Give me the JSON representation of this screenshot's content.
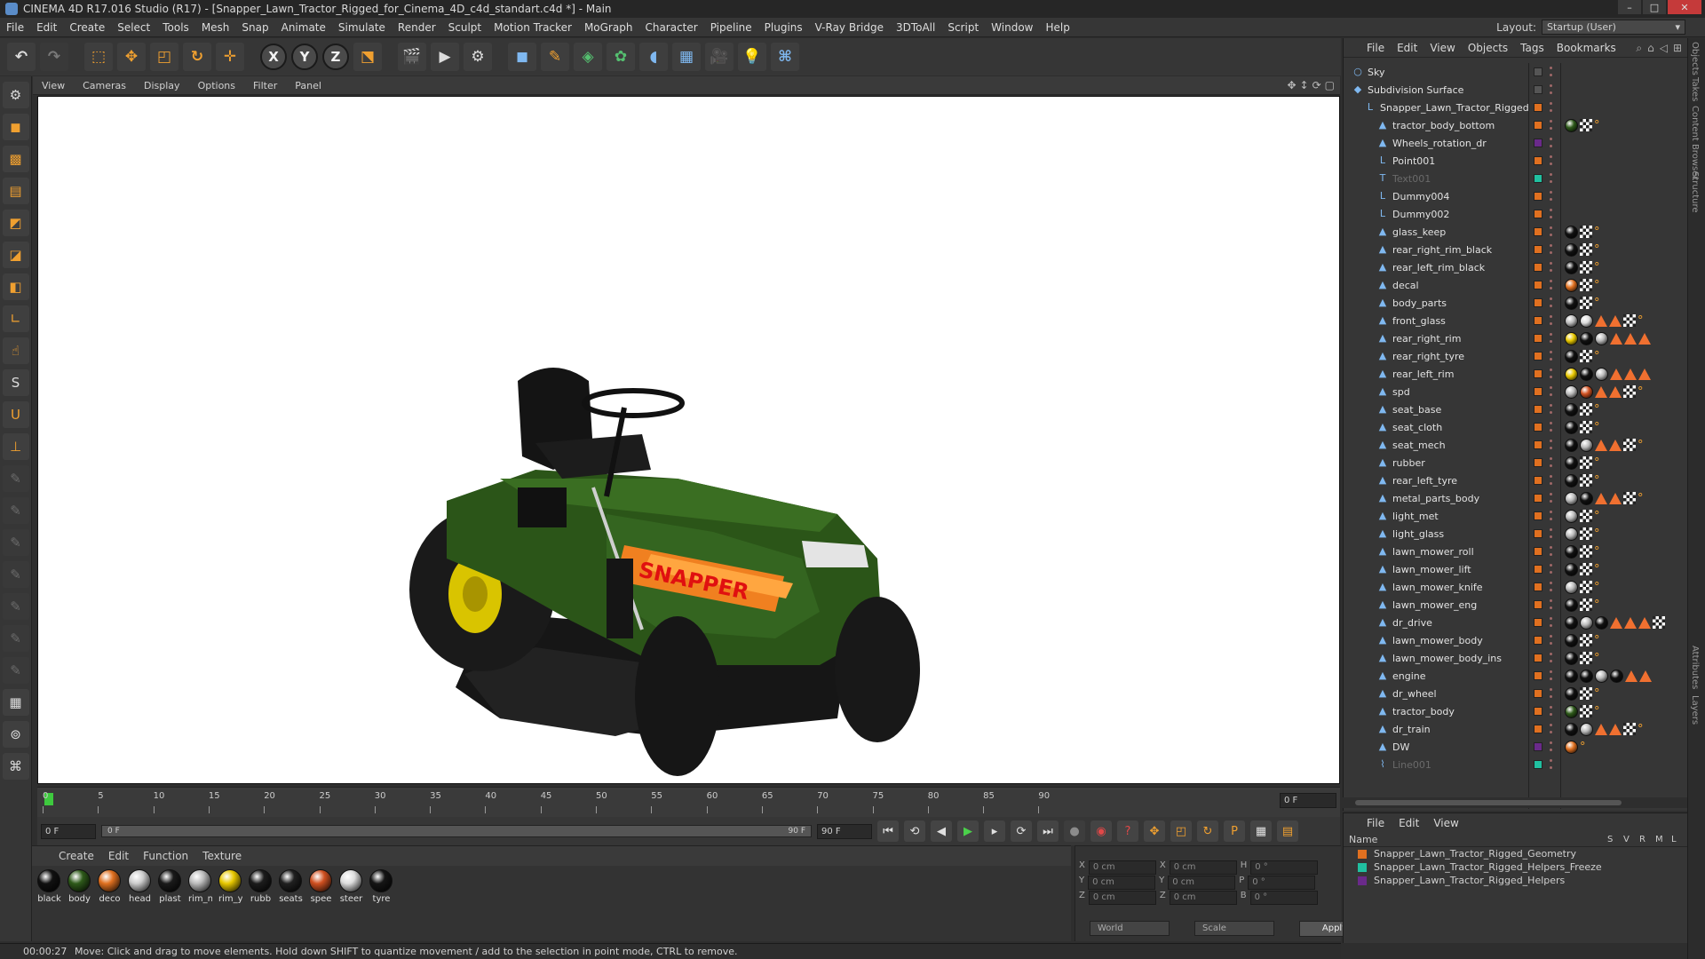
{
  "window": {
    "title": "CINEMA 4D R17.016 Studio (R17) - [Snapper_Lawn_Tractor_Rigged_for_Cinema_4D_c4d_standart.c4d *] - Main"
  },
  "menu": [
    "File",
    "Edit",
    "Create",
    "Select",
    "Tools",
    "Mesh",
    "Snap",
    "Animate",
    "Simulate",
    "Render",
    "Sculpt",
    "Motion Tracker",
    "MoGraph",
    "Character",
    "Pipeline",
    "Plugins",
    "V-Ray Bridge",
    "3DToAll",
    "Script",
    "Window",
    "Help"
  ],
  "layout": {
    "label": "Layout:",
    "value": "Startup (User)"
  },
  "viewport": {
    "menu": [
      "View",
      "Cameras",
      "Display",
      "Options",
      "Filter",
      "Panel"
    ]
  },
  "timeline": {
    "ticks": [
      "0",
      "5",
      "10",
      "15",
      "20",
      "25",
      "30",
      "35",
      "40",
      "45",
      "50",
      "55",
      "60",
      "65",
      "70",
      "75",
      "80",
      "85",
      "90"
    ],
    "frame_end": "0 F",
    "current_frame": "0 F",
    "slider_start": "0 F",
    "slider_end": "90 F",
    "max_frame": "90 F"
  },
  "materials": {
    "menu": [
      "Create",
      "Edit",
      "Function",
      "Texture"
    ],
    "items": [
      {
        "label": "black",
        "color": "#111111"
      },
      {
        "label": "body",
        "color": "#2e5a1a"
      },
      {
        "label": "deco",
        "color": "#e07020"
      },
      {
        "label": "head",
        "color": "#cccccc"
      },
      {
        "label": "plast",
        "color": "#1a1a1a"
      },
      {
        "label": "rim_n",
        "color": "#bbbbbb"
      },
      {
        "label": "rim_y",
        "color": "#e8c800"
      },
      {
        "label": "rubb",
        "color": "#1c1c1c"
      },
      {
        "label": "seats",
        "color": "#202020"
      },
      {
        "label": "spee",
        "color": "#d05020"
      },
      {
        "label": "steer",
        "color": "#dddddd"
      },
      {
        "label": "tyre",
        "color": "#151515"
      }
    ]
  },
  "coords": {
    "rows": [
      {
        "a": "X",
        "av": "0 cm",
        "b": "X",
        "bv": "0 cm",
        "c": "H",
        "cv": "0 °"
      },
      {
        "a": "Y",
        "av": "0 cm",
        "b": "Y",
        "bv": "0 cm",
        "c": "P",
        "cv": "0 °"
      },
      {
        "a": "Z",
        "av": "0 cm",
        "b": "Z",
        "bv": "0 cm",
        "c": "B",
        "cv": "0 °"
      }
    ],
    "world": "World",
    "scale": "Scale",
    "apply": "Apply"
  },
  "status": {
    "time": "00:00:27",
    "message": "Move: Click and drag to move elements. Hold down SHIFT to quantize movement / add to the selection in point mode, CTRL to remove."
  },
  "objects": {
    "menu": [
      "File",
      "Edit",
      "View",
      "Objects",
      "Tags",
      "Bookmarks"
    ],
    "rows": [
      {
        "name": "Sky",
        "level": 0,
        "icon": "○",
        "dot": "#555555"
      },
      {
        "name": "Subdivision Surface",
        "level": 0,
        "icon": "◆",
        "dot": "#555555"
      },
      {
        "name": "Snapper_Lawn_Tractor_Rigged",
        "level": 1,
        "icon": "L",
        "dot": "#e07020"
      },
      {
        "name": "tractor_body_bottom",
        "level": 2,
        "icon": "▲",
        "dot": "#e07020",
        "tags": [
          "#2e5a1a",
          "x",
          "o"
        ]
      },
      {
        "name": "Wheels_rotation_dr",
        "level": 2,
        "icon": "▲",
        "dot": "#6a2a8a"
      },
      {
        "name": "Point001",
        "level": 2,
        "icon": "L",
        "dot": "#e07020"
      },
      {
        "name": "Text001",
        "level": 2,
        "icon": "T",
        "dot": "#20c0a0",
        "dim": true
      },
      {
        "name": "Dummy004",
        "level": 2,
        "icon": "L",
        "dot": "#e07020"
      },
      {
        "name": "Dummy002",
        "level": 2,
        "icon": "L",
        "dot": "#e07020"
      },
      {
        "name": "glass_keep",
        "level": 2,
        "icon": "▲",
        "dot": "#e07020",
        "tags": [
          "#111111",
          "x",
          "o"
        ]
      },
      {
        "name": "rear_right_rim_black",
        "level": 2,
        "icon": "▲",
        "dot": "#e07020",
        "tags": [
          "#111111",
          "x",
          "o"
        ]
      },
      {
        "name": "rear_left_rim_black",
        "level": 2,
        "icon": "▲",
        "dot": "#e07020",
        "tags": [
          "#111111",
          "x",
          "o"
        ]
      },
      {
        "name": "decal",
        "level": 2,
        "icon": "▲",
        "dot": "#e07020",
        "tags": [
          "#e07020",
          "x",
          "o"
        ]
      },
      {
        "name": "body_parts",
        "level": 2,
        "icon": "▲",
        "dot": "#e07020",
        "tags": [
          "#111111",
          "x",
          "o"
        ]
      },
      {
        "name": "front_glass",
        "level": 2,
        "icon": "▲",
        "dot": "#e07020",
        "tags": [
          "#bbbbbb",
          "#dddddd",
          "t",
          "t",
          "x",
          "o"
        ]
      },
      {
        "name": "rear_right_rim",
        "level": 2,
        "icon": "▲",
        "dot": "#e07020",
        "tags": [
          "#e8c800",
          "#111111",
          "#bbbbbb",
          "t",
          "t",
          "t"
        ]
      },
      {
        "name": "rear_right_tyre",
        "level": 2,
        "icon": "▲",
        "dot": "#e07020",
        "tags": [
          "#111111",
          "x",
          "o"
        ]
      },
      {
        "name": "rear_left_rim",
        "level": 2,
        "icon": "▲",
        "dot": "#e07020",
        "tags": [
          "#e8c800",
          "#111111",
          "#bbbbbb",
          "t",
          "t",
          "t"
        ]
      },
      {
        "name": "spd",
        "level": 2,
        "icon": "▲",
        "dot": "#e07020",
        "tags": [
          "#bbbbbb",
          "#d05020",
          "t",
          "t",
          "x",
          "o"
        ]
      },
      {
        "name": "seat_base",
        "level": 2,
        "icon": "▲",
        "dot": "#e07020",
        "tags": [
          "#111111",
          "x",
          "o"
        ]
      },
      {
        "name": "seat_cloth",
        "level": 2,
        "icon": "▲",
        "dot": "#e07020",
        "tags": [
          "#111111",
          "x",
          "o"
        ]
      },
      {
        "name": "seat_mech",
        "level": 2,
        "icon": "▲",
        "dot": "#e07020",
        "tags": [
          "#111111",
          "#bbbbbb",
          "t",
          "t",
          "x",
          "o"
        ]
      },
      {
        "name": "rubber",
        "level": 2,
        "icon": "▲",
        "dot": "#e07020",
        "tags": [
          "#111111",
          "x",
          "o"
        ]
      },
      {
        "name": "rear_left_tyre",
        "level": 2,
        "icon": "▲",
        "dot": "#e07020",
        "tags": [
          "#111111",
          "x",
          "o"
        ]
      },
      {
        "name": "metal_parts_body",
        "level": 2,
        "icon": "▲",
        "dot": "#e07020",
        "tags": [
          "#bbbbbb",
          "#111111",
          "t",
          "t",
          "x",
          "o"
        ]
      },
      {
        "name": "light_met",
        "level": 2,
        "icon": "▲",
        "dot": "#e07020",
        "tags": [
          "#bbbbbb",
          "x",
          "o"
        ]
      },
      {
        "name": "light_glass",
        "level": 2,
        "icon": "▲",
        "dot": "#e07020",
        "tags": [
          "#bbbbbb",
          "x",
          "o"
        ]
      },
      {
        "name": "lawn_mower_roll",
        "level": 2,
        "icon": "▲",
        "dot": "#e07020",
        "tags": [
          "#111111",
          "x",
          "o"
        ]
      },
      {
        "name": "lawn_mower_lift",
        "level": 2,
        "icon": "▲",
        "dot": "#e07020",
        "tags": [
          "#111111",
          "x",
          "o"
        ]
      },
      {
        "name": "lawn_mower_knife",
        "level": 2,
        "icon": "▲",
        "dot": "#e07020",
        "tags": [
          "#bbbbbb",
          "x",
          "o"
        ]
      },
      {
        "name": "lawn_mower_eng",
        "level": 2,
        "icon": "▲",
        "dot": "#e07020",
        "tags": [
          "#111111",
          "x",
          "o"
        ]
      },
      {
        "name": "dr_drive",
        "level": 2,
        "icon": "▲",
        "dot": "#e07020",
        "tags": [
          "#111111",
          "#bbbbbb",
          "#111111",
          "t",
          "t",
          "t",
          "x"
        ]
      },
      {
        "name": "lawn_mower_body",
        "level": 2,
        "icon": "▲",
        "dot": "#e07020",
        "tags": [
          "#111111",
          "x",
          "o"
        ]
      },
      {
        "name": "lawn_mower_body_ins",
        "level": 2,
        "icon": "▲",
        "dot": "#e07020",
        "tags": [
          "#111111",
          "x",
          "o"
        ]
      },
      {
        "name": "engine",
        "level": 2,
        "icon": "▲",
        "dot": "#e07020",
        "tags": [
          "#111111",
          "#111111",
          "#bbbbbb",
          "#111111",
          "t",
          "t"
        ]
      },
      {
        "name": "dr_wheel",
        "level": 2,
        "icon": "▲",
        "dot": "#e07020",
        "tags": [
          "#111111",
          "x",
          "o"
        ]
      },
      {
        "name": "tractor_body",
        "level": 2,
        "icon": "▲",
        "dot": "#e07020",
        "tags": [
          "#2e5a1a",
          "x",
          "o"
        ]
      },
      {
        "name": "dr_train",
        "level": 2,
        "icon": "▲",
        "dot": "#e07020",
        "tags": [
          "#111111",
          "#bbbbbb",
          "t",
          "t",
          "x",
          "o"
        ]
      },
      {
        "name": "DW",
        "level": 2,
        "icon": "▲",
        "dot": "#6a2a8a",
        "tags": [
          "#e07020",
          "o"
        ]
      },
      {
        "name": "Line001",
        "level": 2,
        "icon": "⌇",
        "dot": "#20c0a0",
        "dim": true
      }
    ]
  },
  "layers": {
    "menu": [
      "File",
      "Edit",
      "View"
    ],
    "columns": {
      "name": "Name",
      "s": "S",
      "v": "V",
      "r": "R",
      "m": "M",
      "l": "L"
    },
    "rows": [
      {
        "name": "Snapper_Lawn_Tractor_Rigged_Geometry",
        "color": "#e07020"
      },
      {
        "name": "Snapper_Lawn_Tractor_Rigged_Helpers_Freeze",
        "color": "#20c0a0"
      },
      {
        "name": "Snapper_Lawn_Tractor_Rigged_Helpers",
        "color": "#6a2a8a"
      }
    ]
  },
  "right_tabs": [
    "Objects",
    "Takes",
    "Content Browser",
    "Structure",
    "Attributes",
    "Layers"
  ]
}
